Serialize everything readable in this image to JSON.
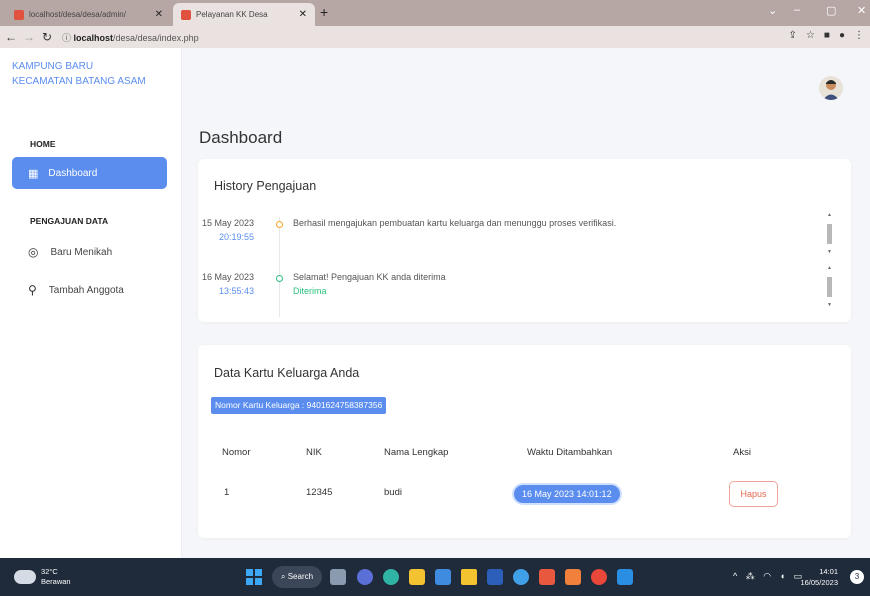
{
  "browser": {
    "tabs": [
      {
        "label": "localhost/desa/desa/admin/"
      },
      {
        "label": "Pelayanan KK Desa"
      }
    ],
    "new_tab": "+",
    "url_prefix": "localhost",
    "url_rest": "/desa/desa/index.php"
  },
  "sidebar": {
    "brand_line1": "KAMPUNG BARU",
    "brand_line2": "KECAMATAN BATANG ASAM",
    "home_label": "HOME",
    "dashboard_label": "Dashboard",
    "pengajuan_label": "PENGAJUAN DATA",
    "items": [
      {
        "label": "Baru Menikah",
        "icon": "user-circle-icon"
      },
      {
        "label": "Tambah Anggota",
        "icon": "user-plus-icon"
      }
    ]
  },
  "main": {
    "page_title": "Dashboard",
    "history": {
      "title": "History Pengajuan",
      "entries": [
        {
          "date": "15 May 2023",
          "time": "20:19:55",
          "text": "Berhasil mengajukan pembuatan kartu keluarga dan menunggu proses verifikasi.",
          "status": "",
          "dot_color": "#f5a623"
        },
        {
          "date": "16 May 2023",
          "time": "13:55:43",
          "text": "Selamat! Pengajuan KK anda diterima",
          "status": "Diterima",
          "dot_color": "#2cc07f"
        }
      ]
    },
    "kk": {
      "title": "Data Kartu Keluarga Anda",
      "badge": "Nomor Kartu Keluarga : 9401624758387356",
      "columns": [
        "Nomor",
        "NIK",
        "Nama Lengkap",
        "Waktu Ditambahkan",
        "Aksi"
      ],
      "rows": [
        {
          "nomor": "1",
          "nik": "12345",
          "nama": "budi",
          "waktu": "16 May 2023 14:01:12",
          "aksi": "Hapus"
        }
      ]
    }
  },
  "taskbar": {
    "temp": "32°C",
    "weather": "Berawan",
    "search": "Search",
    "time": "14:01",
    "date": "16/05/2023"
  },
  "colors": {
    "accent": "#5b8def",
    "success": "#2cc07f",
    "warning": "#f5a623",
    "danger": "#e5674f"
  }
}
